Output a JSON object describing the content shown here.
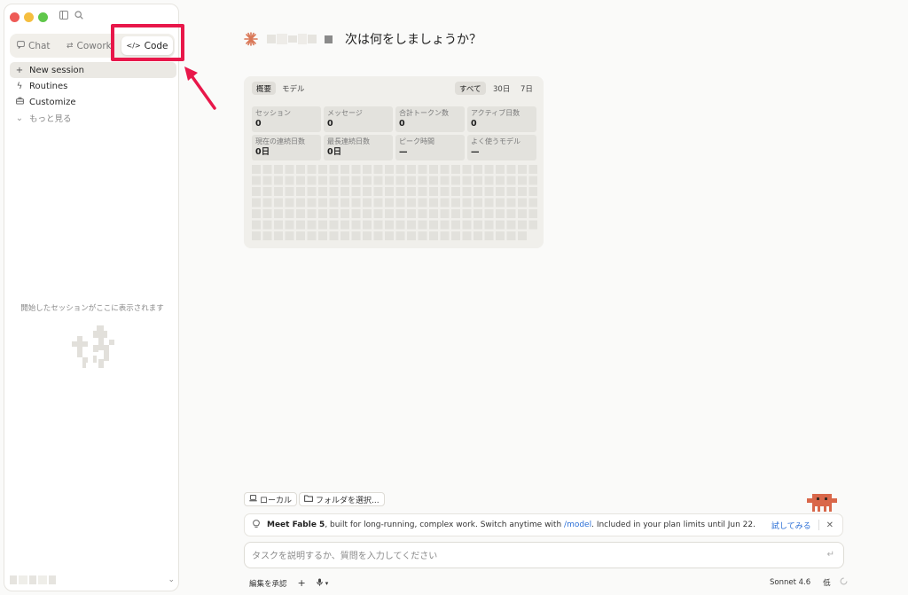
{
  "sidebar": {
    "tabs": [
      {
        "label": "Chat",
        "icon": "chat-bubble-icon"
      },
      {
        "label": "Cowork",
        "icon": "cowork-icon"
      },
      {
        "label": "Code",
        "icon": "code-icon"
      }
    ],
    "nav": [
      {
        "label": "New session",
        "icon": "plus-icon"
      },
      {
        "label": "Routines",
        "icon": "routine-icon"
      },
      {
        "label": "Customize",
        "icon": "briefcase-icon"
      },
      {
        "label": "もっと見る",
        "icon": "chevron-down-icon"
      }
    ],
    "empty_text": "開始したセッションがここに表示されます"
  },
  "main": {
    "greeting": "次は何をしましょうか？",
    "stats": {
      "tabs": [
        "概要",
        "モデル"
      ],
      "ranges": [
        "すべて",
        "30日",
        "7日"
      ],
      "cells": [
        {
          "label": "セッション",
          "value": "0"
        },
        {
          "label": "メッセージ",
          "value": "0"
        },
        {
          "label": "合計トークン数",
          "value": "0"
        },
        {
          "label": "アクティブ日数",
          "value": "0"
        },
        {
          "label": "現在の連続日数",
          "value": "0日"
        },
        {
          "label": "最長連続日数",
          "value": "0日"
        },
        {
          "label": "ピーク時間",
          "value": "—"
        },
        {
          "label": "よく使うモデル",
          "value": "—"
        }
      ]
    },
    "env_buttons": [
      {
        "label": "ローカル",
        "icon": "laptop-icon"
      },
      {
        "label": "フォルダを選択...",
        "icon": "folder-icon"
      }
    ],
    "banner": {
      "title": "Meet Fable 5",
      "text_before": ", built for long-running, complex work. Switch anytime with ",
      "link": "/model",
      "text_after": ". Included in your plan limits until Jun 22.",
      "try_label": "試してみる",
      "close": "✕"
    },
    "input": {
      "placeholder": "タスクを説明するか、質問を入力してください"
    },
    "footer": {
      "approve": "編集を承認",
      "plus": "+",
      "model": "Sonnet 4.6",
      "effort": "低"
    }
  },
  "colors": {
    "accent_red": "#e8174a",
    "link_blue": "#2b6fd6",
    "brand_orange": "#d97757"
  }
}
